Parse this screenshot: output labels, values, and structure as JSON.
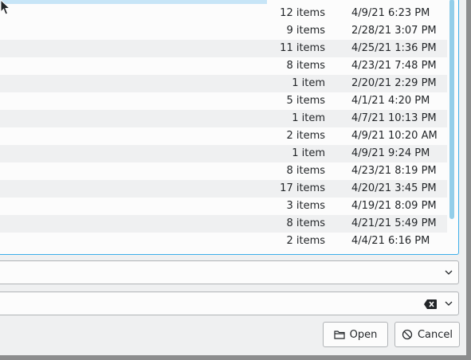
{
  "file_list": {
    "rows": [
      {
        "size": "12 items",
        "modified": "4/9/21 6:23 PM"
      },
      {
        "size": "9 items",
        "modified": "2/28/21 3:07 PM"
      },
      {
        "size": "11 items",
        "modified": "4/25/21 1:36 PM"
      },
      {
        "size": "8 items",
        "modified": "4/23/21 7:48 PM"
      },
      {
        "size": "1 item",
        "modified": "2/20/21 2:29 PM"
      },
      {
        "size": "5 items",
        "modified": "4/1/21 4:20 PM"
      },
      {
        "size": "1 item",
        "modified": "4/7/21 10:13 PM"
      },
      {
        "size": "2 items",
        "modified": "4/9/21 10:20 AM"
      },
      {
        "size": "1 item",
        "modified": "4/9/21 9:24 PM"
      },
      {
        "size": "8 items",
        "modified": "4/23/21 8:19 PM"
      },
      {
        "size": "17 items",
        "modified": "4/20/21 3:45 PM"
      },
      {
        "size": "3 items",
        "modified": "4/19/21 8:09 PM"
      },
      {
        "size": "8 items",
        "modified": "4/21/21 5:49 PM"
      },
      {
        "size": "2 items",
        "modified": "4/4/21 6:16 PM"
      }
    ]
  },
  "location_combo": {
    "value": ""
  },
  "filter_combo": {
    "value": ""
  },
  "buttons": {
    "open_label": "Open",
    "cancel_label": "Cancel"
  },
  "icons": {
    "open": "folder-open-icon",
    "cancel": "cancel-icon",
    "clear": "clear-text-icon",
    "dropdown": "chevron-down-icon",
    "cursor": "mouse-cursor-icon"
  },
  "colors": {
    "accent": "#3daee9",
    "selection": "#c7e5f7",
    "scrollbar": "#93cee9",
    "row_alt": "#eff0f1"
  }
}
